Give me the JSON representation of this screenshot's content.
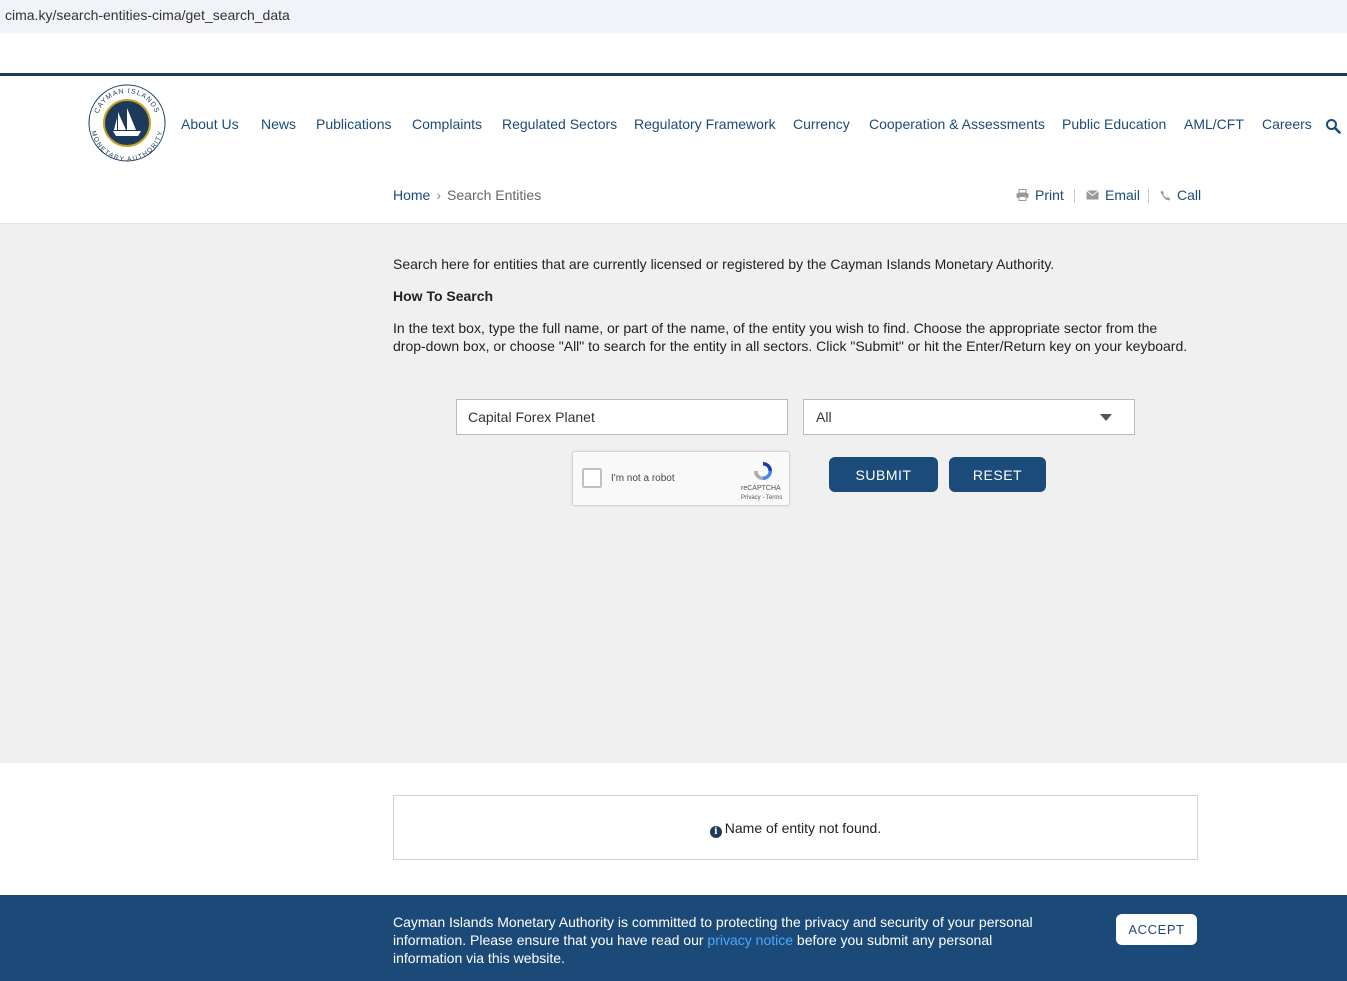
{
  "browser": {
    "url": "cima.ky/search-entities-cima/get_search_data"
  },
  "logo": {
    "text_top": "CAYMAN ISLANDS",
    "text_bottom": "MONETARY AUTHORITY"
  },
  "nav": {
    "items": [
      "About Us",
      "News",
      "Publications",
      "Complaints",
      "Regulated Sectors",
      "Regulatory Framework",
      "Currency",
      "Cooperation & Assessments",
      "Public Education",
      "AML/CFT",
      "Careers"
    ]
  },
  "breadcrumb": {
    "home": "Home",
    "current": "Search Entities"
  },
  "tools": {
    "print": "Print",
    "email": "Email",
    "call": "Call"
  },
  "content": {
    "intro": "Search here for entities that are currently licensed or registered by the Cayman Islands Monetary Authority.",
    "how_title": "How To Search",
    "how_text": "In the text box, type the full name, or part of the name, of the entity you wish to find. Choose the appropriate sector from the drop-down box, or choose \"All\" to search for the entity in all sectors. Click \"Submit\" or hit the Enter/Return key on your keyboard."
  },
  "search": {
    "value": "Capital Forex Planet",
    "sector_selected": "All"
  },
  "captcha": {
    "label": "I'm not a robot",
    "brand": "reCAPTCHA",
    "links": "Privacy - Terms"
  },
  "buttons": {
    "submit": "SUBMIT",
    "reset": "RESET"
  },
  "result": {
    "message": "Name of entity not found."
  },
  "cookie": {
    "text_before": "Cayman Islands Monetary Authority is committed to protecting the privacy and security of your personal information. Please ensure that you have read our ",
    "link": "privacy notice",
    "text_after": " before you submit any personal information via this website.",
    "accept": "ACCEPT"
  },
  "colors": {
    "primary": "#1b4b7a",
    "dark": "#1b3a5c",
    "cookie_bg": "#1c4a78",
    "link": "#4aa8ff",
    "gray_bg": "#f0f0f0"
  },
  "icons": {
    "search": "magnifier-icon",
    "print": "printer-icon",
    "email": "envelope-icon",
    "call": "phone-icon",
    "info": "info-circle-icon"
  }
}
